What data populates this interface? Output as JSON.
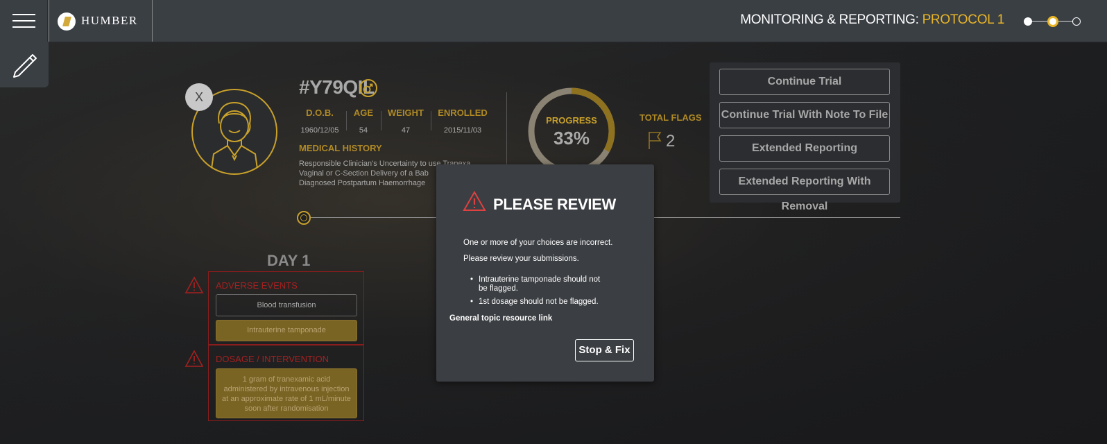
{
  "header": {
    "brand": "HUMBER",
    "title_prefix": "MONITORING & REPORTING: ",
    "title_protocol": "PROTOCOL 1",
    "steps_count": 3,
    "active_step": 2
  },
  "patient": {
    "id": "#Y79QIL",
    "gender_icon": "male-icon",
    "close_label": "X",
    "stats": [
      {
        "label": "D.O.B.",
        "value": "1960/12/05"
      },
      {
        "label": "AGE",
        "value": "54"
      },
      {
        "label": "WEIGHT",
        "value": "47"
      },
      {
        "label": "ENROLLED",
        "value": "2015/11/03"
      }
    ],
    "medical_history_title": "MEDICAL HISTORY",
    "medical_history": [
      "Responsible Clinician's Uncertainty to use Tranexa",
      "Vaginal or C-Section Delivery of a Bab",
      "Diagnosed Postpartum Haemorrhage"
    ]
  },
  "progress": {
    "label": "PROGRESS",
    "value_text": "33%",
    "fraction": 0.33
  },
  "flags": {
    "label": "TOTAL FLAGS",
    "value": "2"
  },
  "actions": [
    "Continue Trial",
    "Continue Trial With Note To File",
    "Extended Reporting",
    "Extended Reporting With Removal"
  ],
  "day": {
    "label": "DAY 1",
    "adverse_events": {
      "title": "ADVERSE EVENTS",
      "items": [
        "Blood transfusion",
        "Intrauterine tamponade"
      ]
    },
    "dosage": {
      "title": "DOSAGE / INTERVENTION",
      "items": [
        "1 gram of tranexamic acid administered by intravenous injection at an approximate rate of 1 mL/minute soon after randomisation"
      ]
    }
  },
  "modal": {
    "title": "PLEASE REVIEW",
    "line1": "One or more of your choices are incorrect.",
    "line2": "Please review your submissions.",
    "bullet1_a": "Intrauterine tamponade should not",
    "bullet1_b": "be flagged.",
    "bullet2": "1st dosage should not be flagged.",
    "link": "General topic resource link",
    "button": "Stop & Fix"
  },
  "colors": {
    "accent": "#e8b528",
    "gold": "#c9a12a",
    "warning": "#a52020"
  }
}
